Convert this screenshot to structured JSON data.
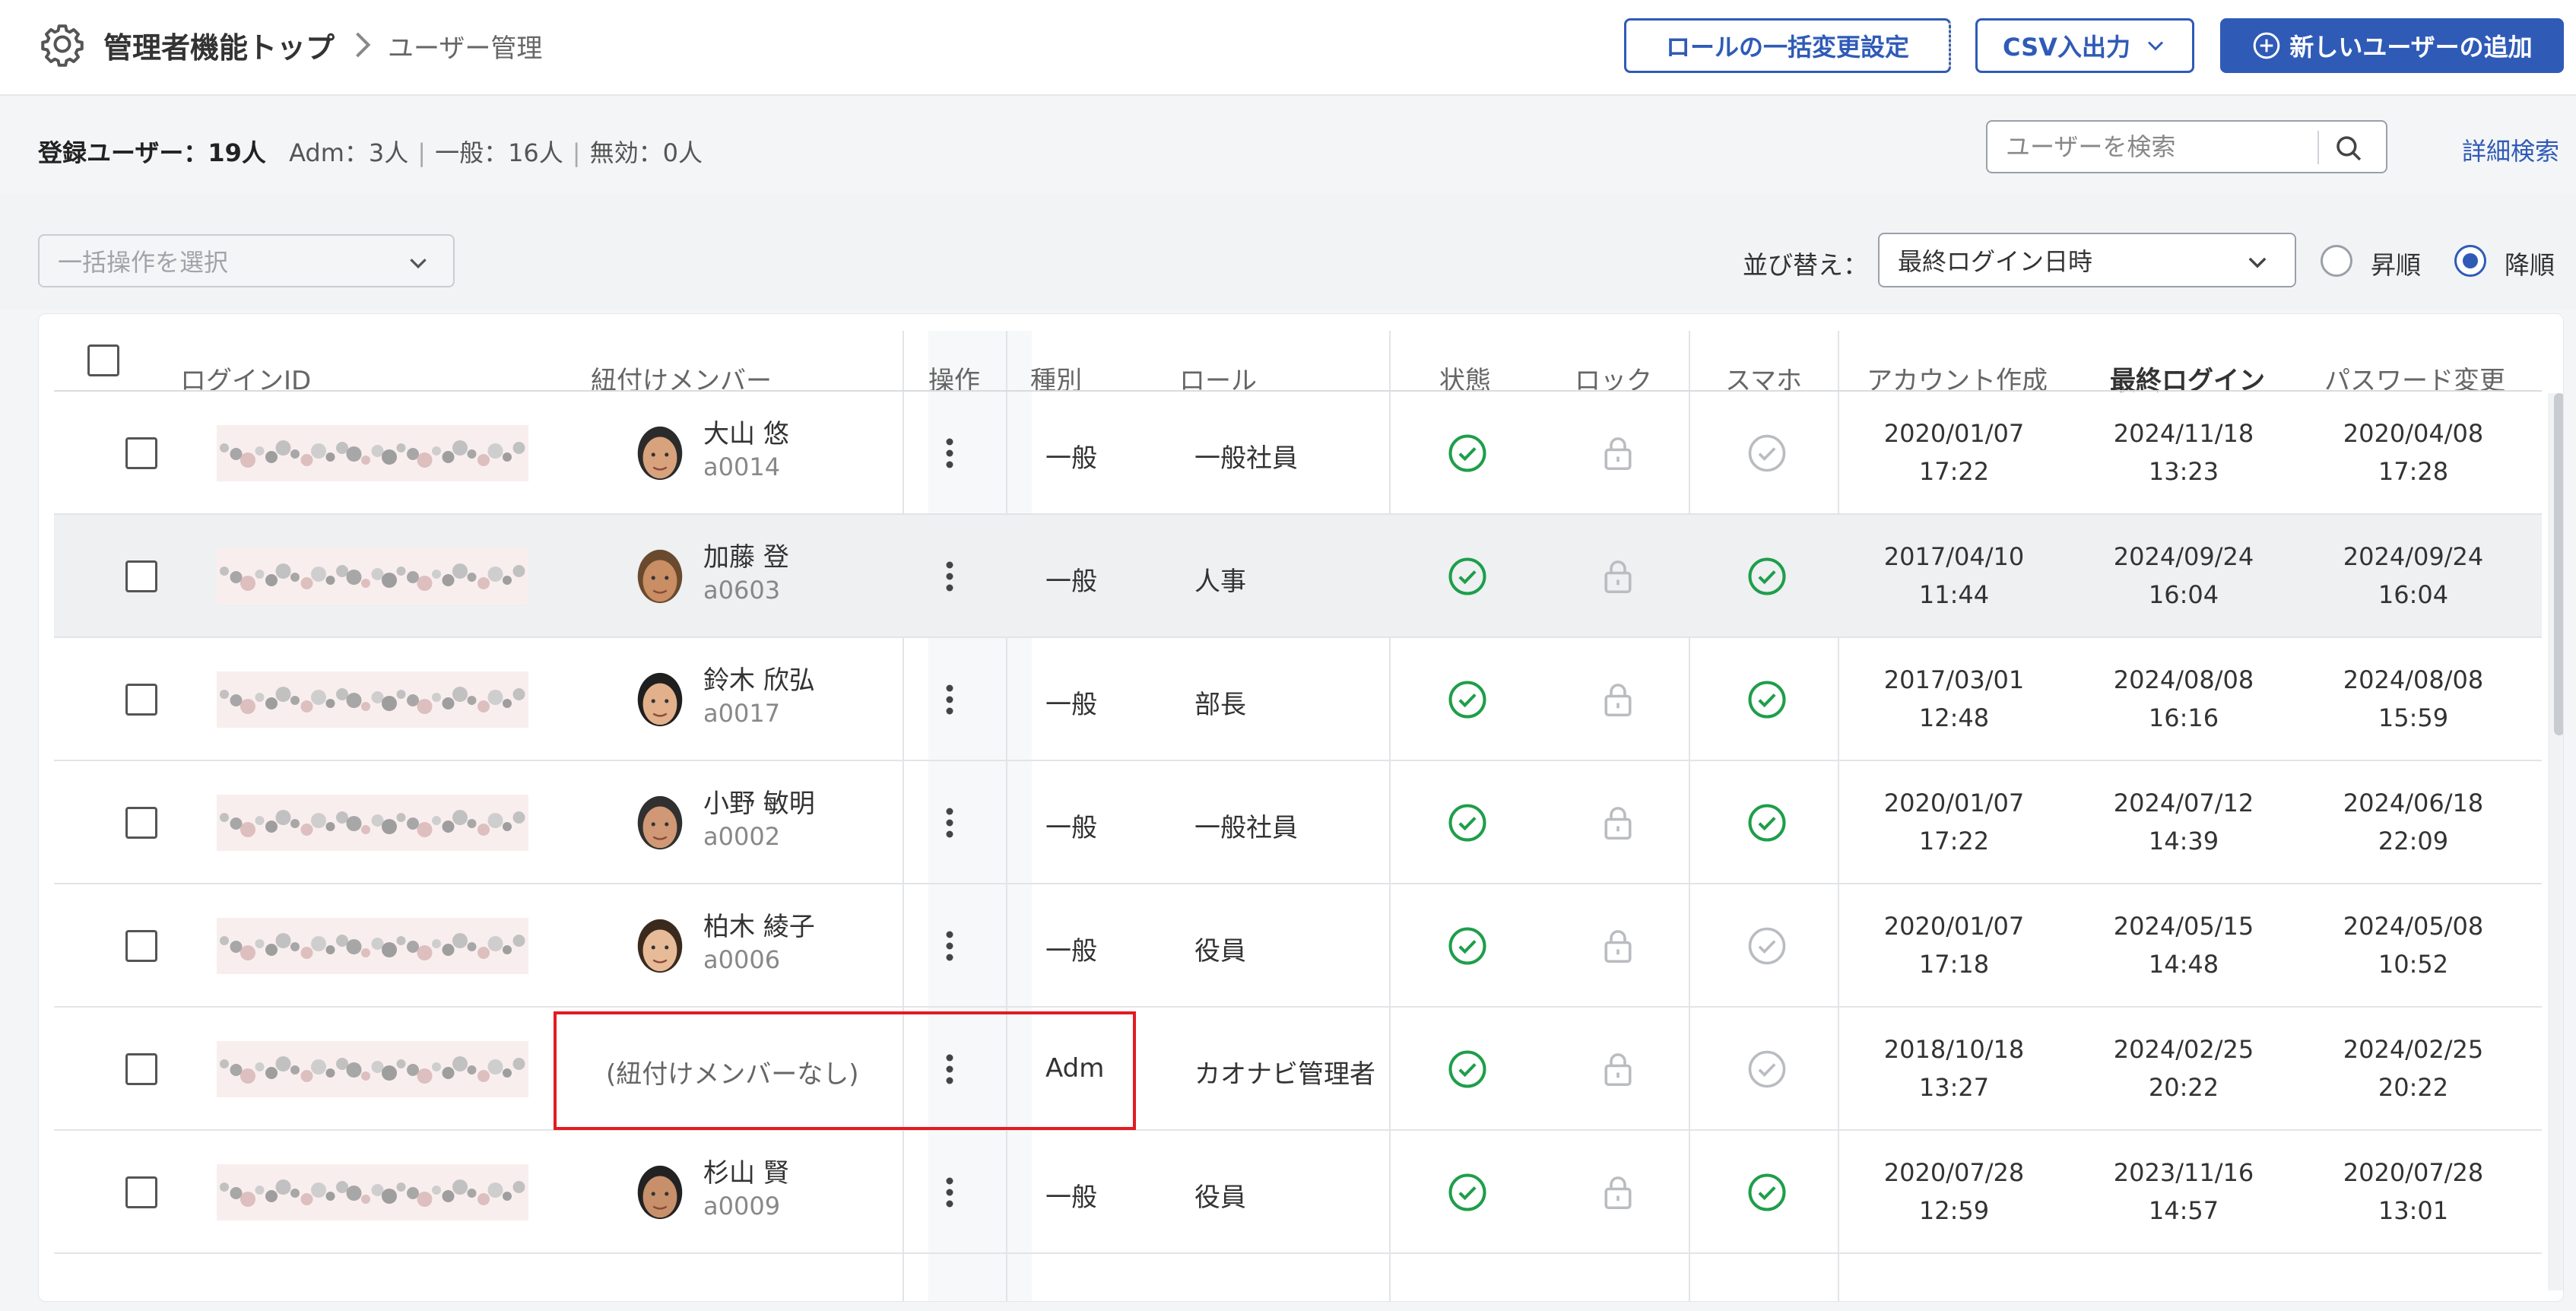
{
  "breadcrumb": {
    "title": "管理者機能トップ",
    "current": "ユーザー管理"
  },
  "header": {
    "role_bulk_label": "ロールの一括変更設定",
    "csv_label": "CSV入出力",
    "add_user_label": "新しいユーザーの追加"
  },
  "summary": {
    "label": "登録ユーザー：",
    "total": "19人",
    "adm": "Adm：3人",
    "general": "一般：16人",
    "disabled": "無効：0人"
  },
  "search": {
    "placeholder": "ユーザーを検索",
    "advanced_label": "詳細検索"
  },
  "bulk": {
    "placeholder": "一括操作を選択"
  },
  "sort": {
    "label": "並び替え：",
    "selected": "最終ログイン日時",
    "asc_label": "昇順",
    "desc_label": "降順",
    "order": "desc"
  },
  "table": {
    "headers": {
      "login_id": "ログインID",
      "member": "紐付けメンバー",
      "ops": "操作",
      "kind": "種別",
      "role": "ロール",
      "status": "状態",
      "lock": "ロック",
      "phone": "スマホ",
      "created": "アカウント作成",
      "last_login": "最終ログイン",
      "pw_changed": "パスワード変更"
    },
    "no_member_label": "(紐付けメンバーなし)",
    "rows": [
      {
        "member_name": "大山 悠",
        "member_id": "a0014",
        "kind": "一般",
        "role": "一般社員",
        "status": "active",
        "phone": "inactive",
        "created_date": "2020/01/07",
        "created_time": "17:22",
        "login_date": "2024/11/18",
        "login_time": "13:23",
        "pw_date": "2020/04/08",
        "pw_time": "17:28"
      },
      {
        "member_name": "加藤 登",
        "member_id": "a0603",
        "kind": "一般",
        "role": "人事",
        "status": "active",
        "phone": "active",
        "created_date": "2017/04/10",
        "created_time": "11:44",
        "login_date": "2024/09/24",
        "login_time": "16:04",
        "pw_date": "2024/09/24",
        "pw_time": "16:04"
      },
      {
        "member_name": "鈴木 欣弘",
        "member_id": "a0017",
        "kind": "一般",
        "role": "部長",
        "status": "active",
        "phone": "active",
        "created_date": "2017/03/01",
        "created_time": "12:48",
        "login_date": "2024/08/08",
        "login_time": "16:16",
        "pw_date": "2024/08/08",
        "pw_time": "15:59"
      },
      {
        "member_name": "小野 敏明",
        "member_id": "a0002",
        "kind": "一般",
        "role": "一般社員",
        "status": "active",
        "phone": "active",
        "created_date": "2020/01/07",
        "created_time": "17:22",
        "login_date": "2024/07/12",
        "login_time": "14:39",
        "pw_date": "2024/06/18",
        "pw_time": "22:09"
      },
      {
        "member_name": "柏木 綾子",
        "member_id": "a0006",
        "kind": "一般",
        "role": "役員",
        "status": "active",
        "phone": "inactive",
        "created_date": "2020/01/07",
        "created_time": "17:18",
        "login_date": "2024/05/15",
        "login_time": "14:48",
        "pw_date": "2024/05/08",
        "pw_time": "10:52"
      },
      {
        "member_name": "",
        "member_id": "",
        "kind": "Adm",
        "role": "カオナビ管理者",
        "status": "active",
        "phone": "inactive",
        "created_date": "2018/10/18",
        "created_time": "13:27",
        "login_date": "2024/02/25",
        "login_time": "20:22",
        "pw_date": "2024/02/25",
        "pw_time": "20:22"
      },
      {
        "member_name": "杉山 賢",
        "member_id": "a0009",
        "kind": "一般",
        "role": "役員",
        "status": "active",
        "phone": "active",
        "created_date": "2020/07/28",
        "created_time": "12:59",
        "login_date": "2023/11/16",
        "login_time": "14:57",
        "pw_date": "2020/07/28",
        "pw_time": "13:01"
      }
    ]
  },
  "colors": {
    "accent": "#2f5bb7",
    "ok_green": "#1e9e4a",
    "highlight": "#e21b22"
  }
}
